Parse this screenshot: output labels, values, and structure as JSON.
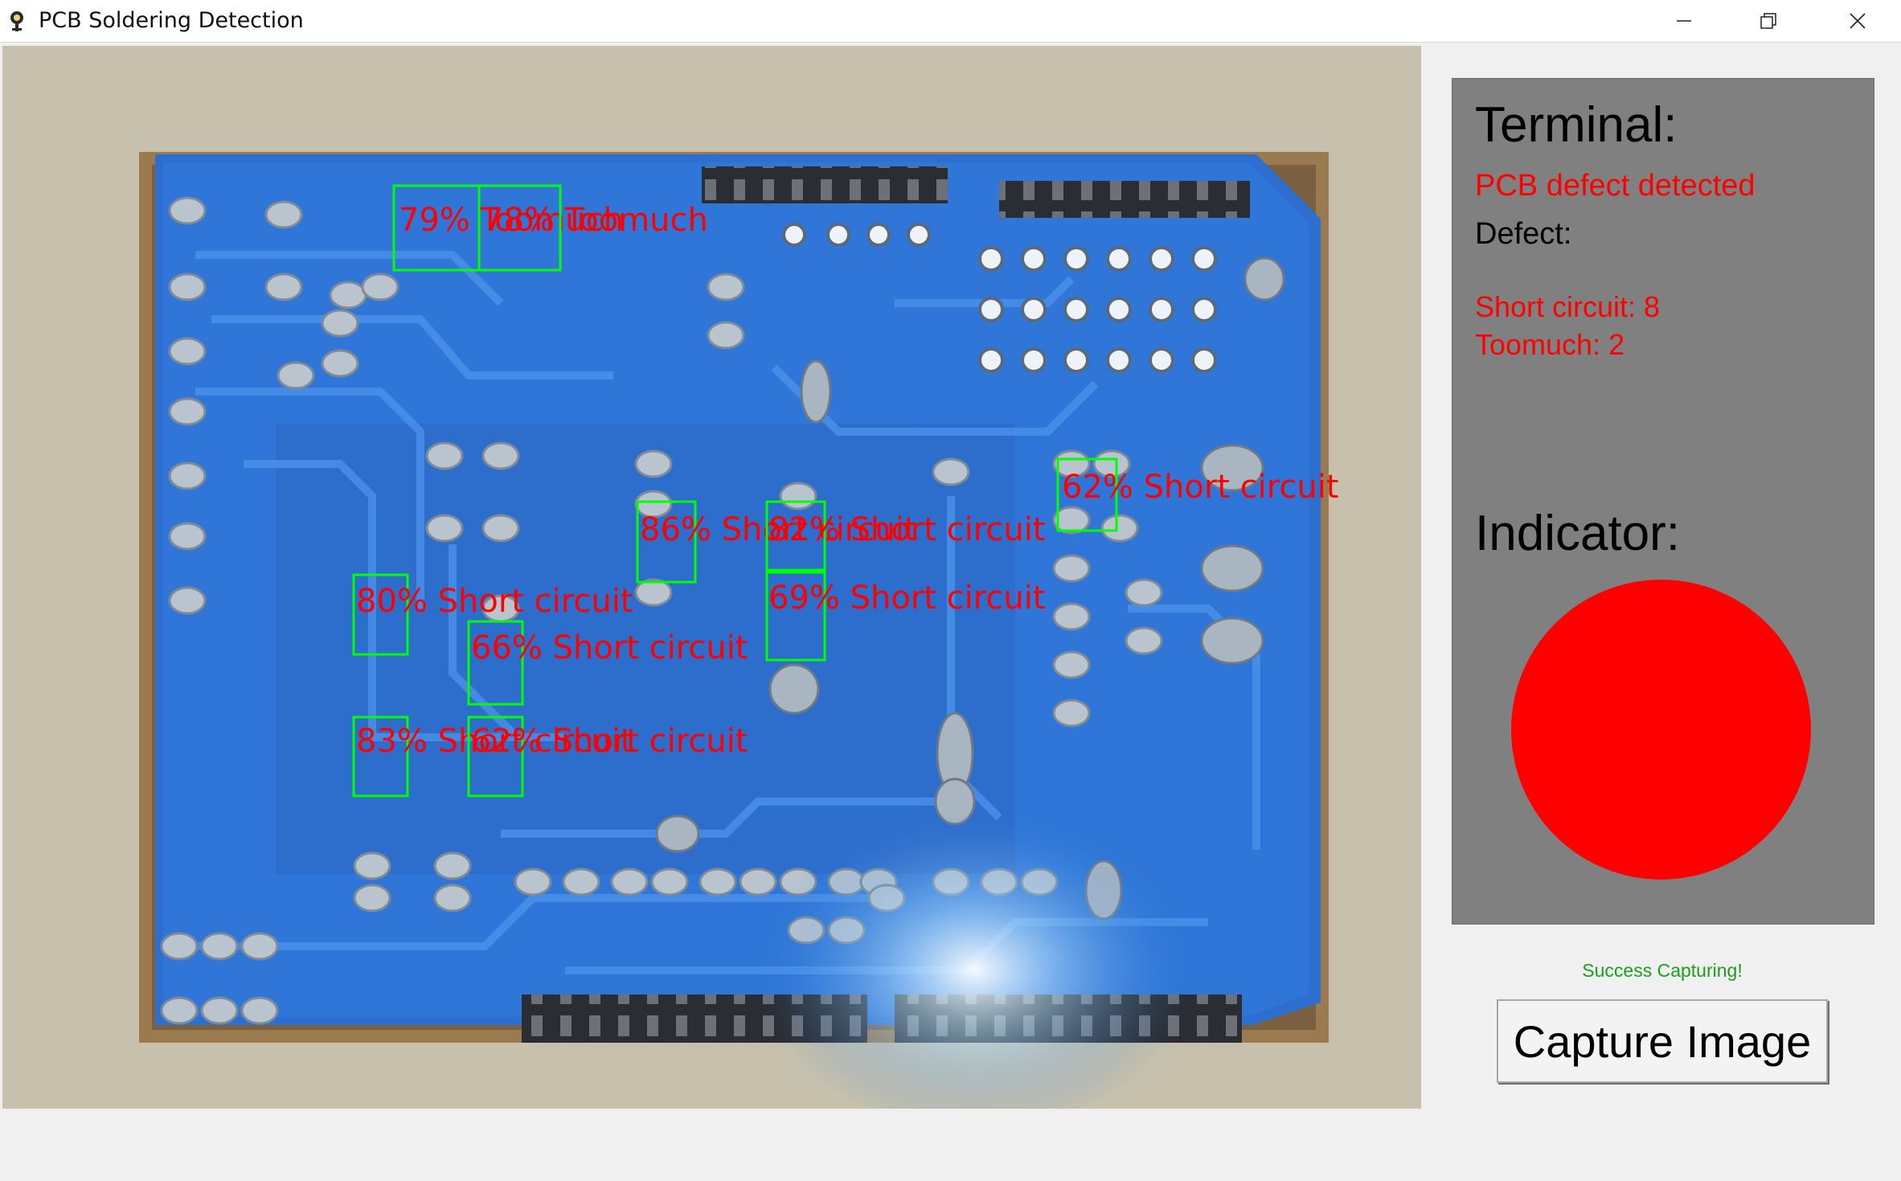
{
  "window": {
    "title": "PCB Soldering Detection"
  },
  "camera": {
    "detections": [
      {
        "label": "79% Toomuch"
      },
      {
        "label": "78% Toomuch"
      },
      {
        "label": "62% Short circuit"
      },
      {
        "label": "86% Short circuit"
      },
      {
        "label": "82% Short circuit"
      },
      {
        "label": "80% Short circuit"
      },
      {
        "label": "69% Short circuit"
      },
      {
        "label": "66% Short circuit"
      },
      {
        "label": "83% Short circuit"
      },
      {
        "label": "62% Short circuit"
      }
    ],
    "box_color": "#00ff00",
    "label_color": "#ff0000"
  },
  "terminal": {
    "heading": "Terminal:",
    "status": "PCB defect detected",
    "defect_label": "Defect:",
    "short_circuit": "Short circuit: 8",
    "toomuch": "Toomuch: 2",
    "indicator_heading": "Indicator:",
    "indicator_color": "#ff0000"
  },
  "status_message": "Success Capturing!",
  "capture_button": "Capture Image"
}
